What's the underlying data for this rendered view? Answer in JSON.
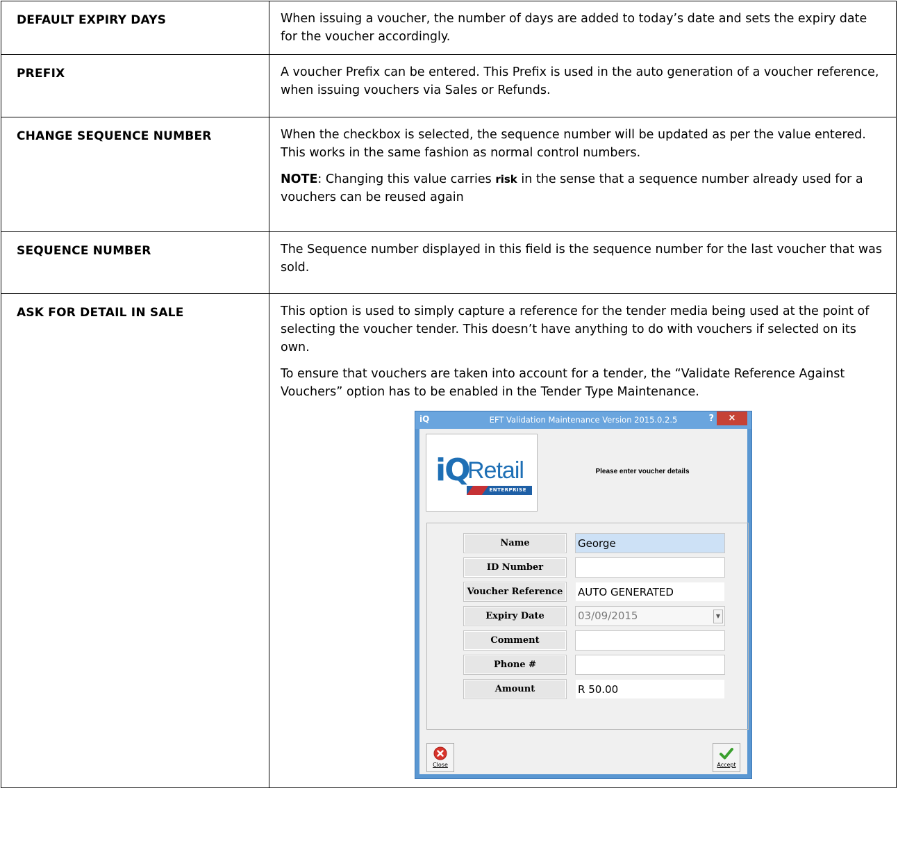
{
  "rows": [
    {
      "term": "DEFAULT EXPIRY DAYS",
      "description": "When issuing a voucher, the number of days are added to today’s date and sets the expiry date for the voucher accordingly."
    },
    {
      "term": "PREFIX",
      "description": "A voucher Prefix can be entered. This Prefix is used in the auto generation of a voucher reference, when issuing vouchers via Sales or Refunds."
    },
    {
      "term": "CHANGE SEQUENCE NUMBER",
      "description": "When the checkbox is selected, the sequence number will be updated as per the value entered. This works in the same fashion as normal control numbers.",
      "note_label": "NOTE",
      "note_before": ": Changing this value carries ",
      "note_risk": "risk",
      "note_after": " in the sense that a sequence number already used for a vouchers can be reused again"
    },
    {
      "term": "SEQUENCE NUMBER",
      "description": "The Sequence number displayed in this field is the sequence number for the last voucher that was sold."
    },
    {
      "term": "ASK FOR DETAIL IN SALE",
      "description": "This option is used to simply capture a reference for the tender media being used at the point of selecting the voucher tender. This doesn’t have anything to do with vouchers if selected on its own.",
      "description2": "To ensure that vouchers are taken into account for a tender, the “Validate Reference Against Vouchers” option has to be enabled in the Tender Type Maintenance."
    }
  ],
  "dialog": {
    "app_icon": "iQ",
    "title": "EFT Validation Maintenance Version 2015.0.2.5",
    "help": "?",
    "close": "×",
    "logo": {
      "iq": "iQ",
      "retail": "Retail",
      "ribbon": "ENTERPRISE"
    },
    "prompt": "Please enter voucher details",
    "fields": [
      {
        "label": "Name",
        "value": "George"
      },
      {
        "label": "ID Number",
        "value": ""
      },
      {
        "label": "Voucher Reference",
        "value": "AUTO GENERATED"
      },
      {
        "label": "Expiry Date",
        "value": "03/09/2015"
      },
      {
        "label": "Comment",
        "value": ""
      },
      {
        "label": "Phone #",
        "value": ""
      },
      {
        "label": "Amount",
        "value": "R 50.00"
      }
    ],
    "buttons": {
      "close": "Close",
      "accept": "Accept"
    },
    "colors": {
      "titlebar": "#6aa5de",
      "close_red": "#c64236",
      "accept_green": "#3aa02e",
      "highlight": "#cde1f6"
    }
  }
}
